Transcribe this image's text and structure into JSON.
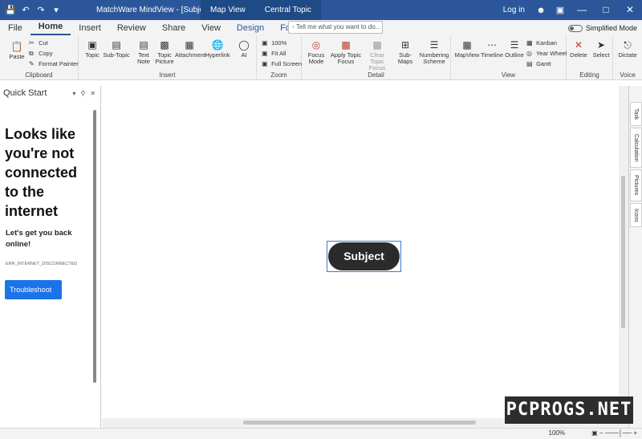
{
  "app": {
    "title": "MatchWare MindView - [Subject]",
    "context_tabs": [
      "Map View",
      "Central Topic"
    ],
    "login": "Log in",
    "qa_icons": [
      "save-icon",
      "undo-icon",
      "redo-icon",
      "customize-icon"
    ]
  },
  "tabs": [
    {
      "label": "File",
      "active": false,
      "ctx": false
    },
    {
      "label": "Home",
      "active": true,
      "ctx": false
    },
    {
      "label": "Insert",
      "active": false,
      "ctx": false
    },
    {
      "label": "Review",
      "active": false,
      "ctx": false
    },
    {
      "label": "Share",
      "active": false,
      "ctx": false
    },
    {
      "label": "View",
      "active": false,
      "ctx": false
    },
    {
      "label": "Design",
      "active": false,
      "ctx": true
    },
    {
      "label": "Format",
      "active": false,
      "ctx": true
    }
  ],
  "tell_me": "Tell me what you want to do...",
  "simplified_mode": "Simplified Mode",
  "ribbon": {
    "groups": {
      "clipboard": "Clipboard",
      "insert": "Insert",
      "zoom": "Zoom",
      "detail": "Detail",
      "view": "View",
      "editing": "Editing",
      "voice": "Voice"
    },
    "clipboard": {
      "paste": "Paste",
      "cut": "Cut",
      "copy": "Copy",
      "format_painter": "Format Painter"
    },
    "insert": {
      "topic": "Topic",
      "subtopic": "Sub-Topic",
      "text_note": "Text Note",
      "topic_picture": "Topic Picture",
      "attachment": "Attachment",
      "hyperlink": "Hyperlink",
      "ai": "AI"
    },
    "zoom": {
      "pct": "100%",
      "fit_all": "Fit All",
      "full_screen": "Full Screen"
    },
    "detail": {
      "focus_mode": "Focus Mode",
      "apply_topic_focus": "Apply Topic Focus",
      "clear_topic_focus": "Clear Topic Focus",
      "submaps": "Sub-Maps",
      "numbering": "Numbering Scheme"
    },
    "view": {
      "mapview": "MapView",
      "timeline": "Timeline",
      "outline": "Outline",
      "kanban": "Kanban",
      "year_wheel": "Year Wheel",
      "gantt": "Gantt"
    },
    "editing": {
      "delete": "Delete",
      "select": "Select"
    },
    "voice": {
      "dictate": "Dictate"
    }
  },
  "quick_start": {
    "title": "Quick Start",
    "heading": "Looks like you're not connected to the internet",
    "subtext": "Let's get you back online!",
    "code": "ERR_INTERNET_DISCONNECTED",
    "button": "Troubleshoot"
  },
  "canvas": {
    "central_topic": "Subject"
  },
  "side_tabs": [
    "Task",
    "Calculation",
    "Pictures",
    "Icons"
  ],
  "status": {
    "zoom": "100%"
  },
  "watermark": "PCPROGS.NET"
}
